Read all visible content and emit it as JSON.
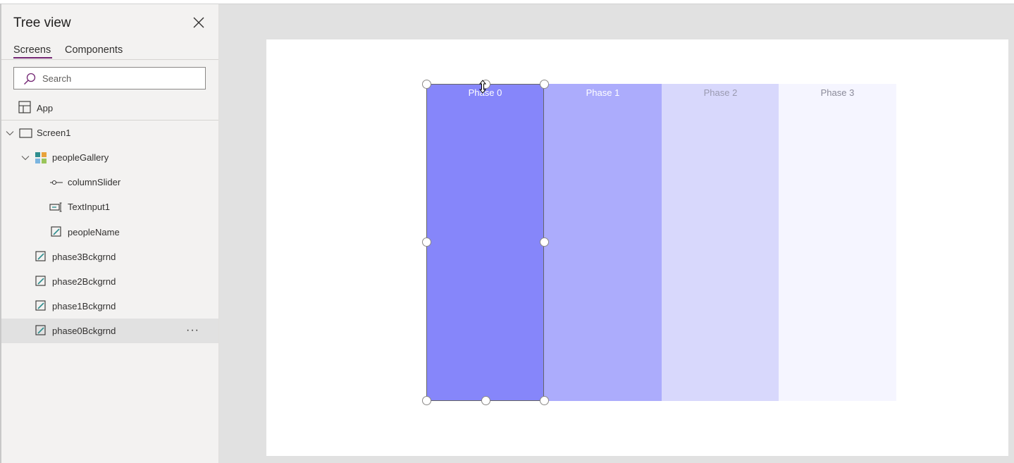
{
  "panel": {
    "title": "Tree view",
    "tabs": [
      {
        "label": "Screens",
        "active": true
      },
      {
        "label": "Components",
        "active": false
      }
    ],
    "search_placeholder": "Search",
    "app_label": "App",
    "items": [
      {
        "label": "Screen1",
        "icon": "screen-icon",
        "expanded": true
      },
      {
        "label": "peopleGallery",
        "icon": "gallery-icon",
        "expanded": true
      },
      {
        "label": "columnSlider",
        "icon": "slider-icon"
      },
      {
        "label": "TextInput1",
        "icon": "text-input-icon"
      },
      {
        "label": "peopleName",
        "icon": "edit-label-icon"
      },
      {
        "label": "phase3Bckgrnd",
        "icon": "edit-label-icon"
      },
      {
        "label": "phase2Bckgrnd",
        "icon": "edit-label-icon"
      },
      {
        "label": "phase1Bckgrnd",
        "icon": "edit-label-icon"
      },
      {
        "label": "phase0Bckgrnd",
        "icon": "edit-label-icon",
        "selected": true,
        "more": "···"
      }
    ]
  },
  "canvas": {
    "phases": [
      {
        "label": "Phase 0",
        "color": "#8686fa",
        "text_color": "#ffffff"
      },
      {
        "label": "Phase 1",
        "color": "#acacfc",
        "text_color": "#ffffff"
      },
      {
        "label": "Phase 2",
        "color": "#d8d8fc",
        "text_color": "#9a9ab0"
      },
      {
        "label": "Phase 3",
        "color": "#f5f5ff",
        "text_color": "#8a8a99"
      }
    ]
  },
  "colors": {
    "accent": "#742774",
    "teal": "#2f8e8e"
  }
}
